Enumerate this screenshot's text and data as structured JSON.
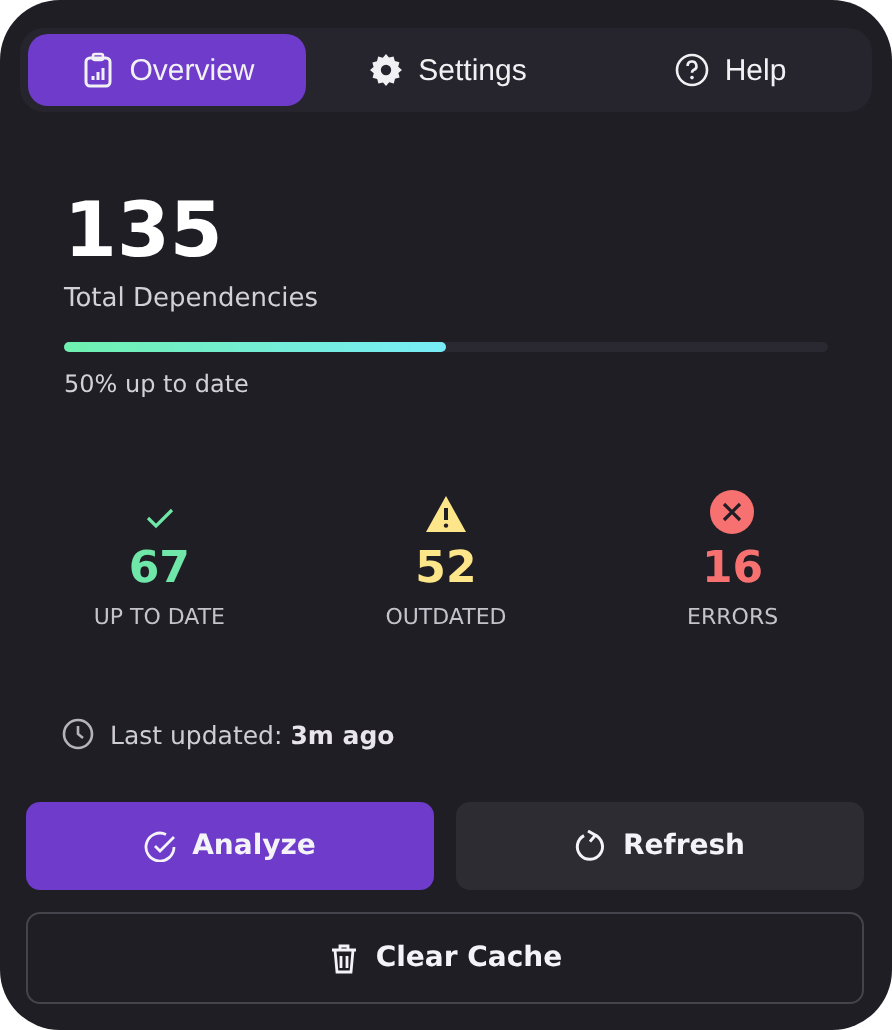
{
  "tabs": [
    {
      "label": "Overview",
      "selected": true
    },
    {
      "label": "Settings",
      "selected": false
    },
    {
      "label": "Help",
      "selected": false
    }
  ],
  "summary": {
    "total": "135",
    "total_label": "Total Dependencies",
    "progress": {
      "level": 0.5,
      "caption": "50% up to date"
    }
  },
  "stats": [
    {
      "kind": "success",
      "value": "67",
      "label": "UP TO DATE"
    },
    {
      "kind": "warning",
      "value": "52",
      "label": "OUTDATED"
    },
    {
      "kind": "error",
      "value": "16",
      "label": "ERRORS"
    }
  ],
  "last_updated": "Last updated: **3m ago**",
  "buttons": [
    {
      "kind": "primary",
      "label": "Analyze"
    },
    {
      "kind": "secondary",
      "label": "Refresh"
    },
    {
      "kind": "outline",
      "label": "Clear Cache"
    }
  ]
}
